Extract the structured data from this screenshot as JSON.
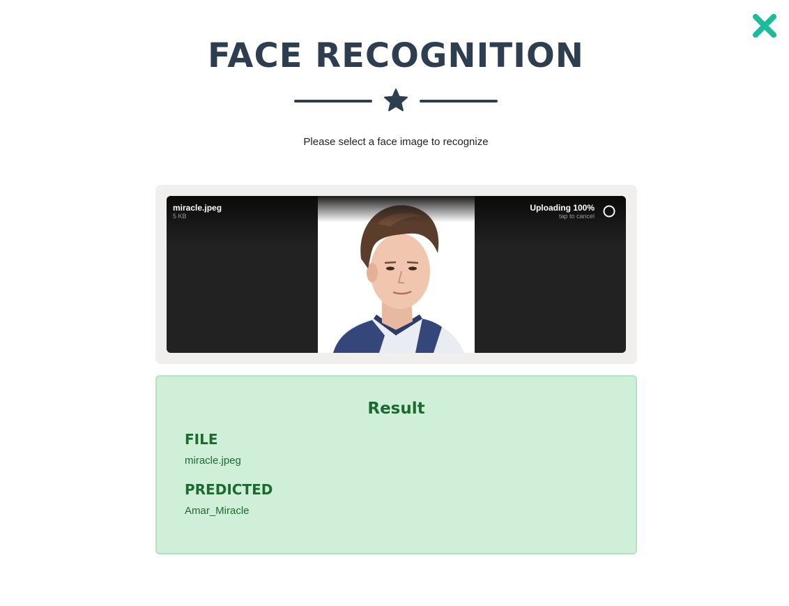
{
  "header": {
    "title": "FACE RECOGNITION",
    "subtitle": "Please select a face image to recognize",
    "divider_icon": "star-icon",
    "close_icon": "close-icon"
  },
  "upload": {
    "file_name": "miracle.jpeg",
    "file_size": "5 KB",
    "status": "Uploading 100%",
    "cancel_hint": "tap to cancel",
    "progress": 1.0
  },
  "result": {
    "title": "Result",
    "file_label": "FILE",
    "file_value": "miracle.jpeg",
    "predicted_label": "PREDICTED",
    "predicted_value": "Amar_Miracle"
  },
  "colors": {
    "accent": "#1abc9c",
    "heading": "#2c3e50",
    "result_bg": "#cfefd9",
    "result_text": "#1c6b2e"
  }
}
